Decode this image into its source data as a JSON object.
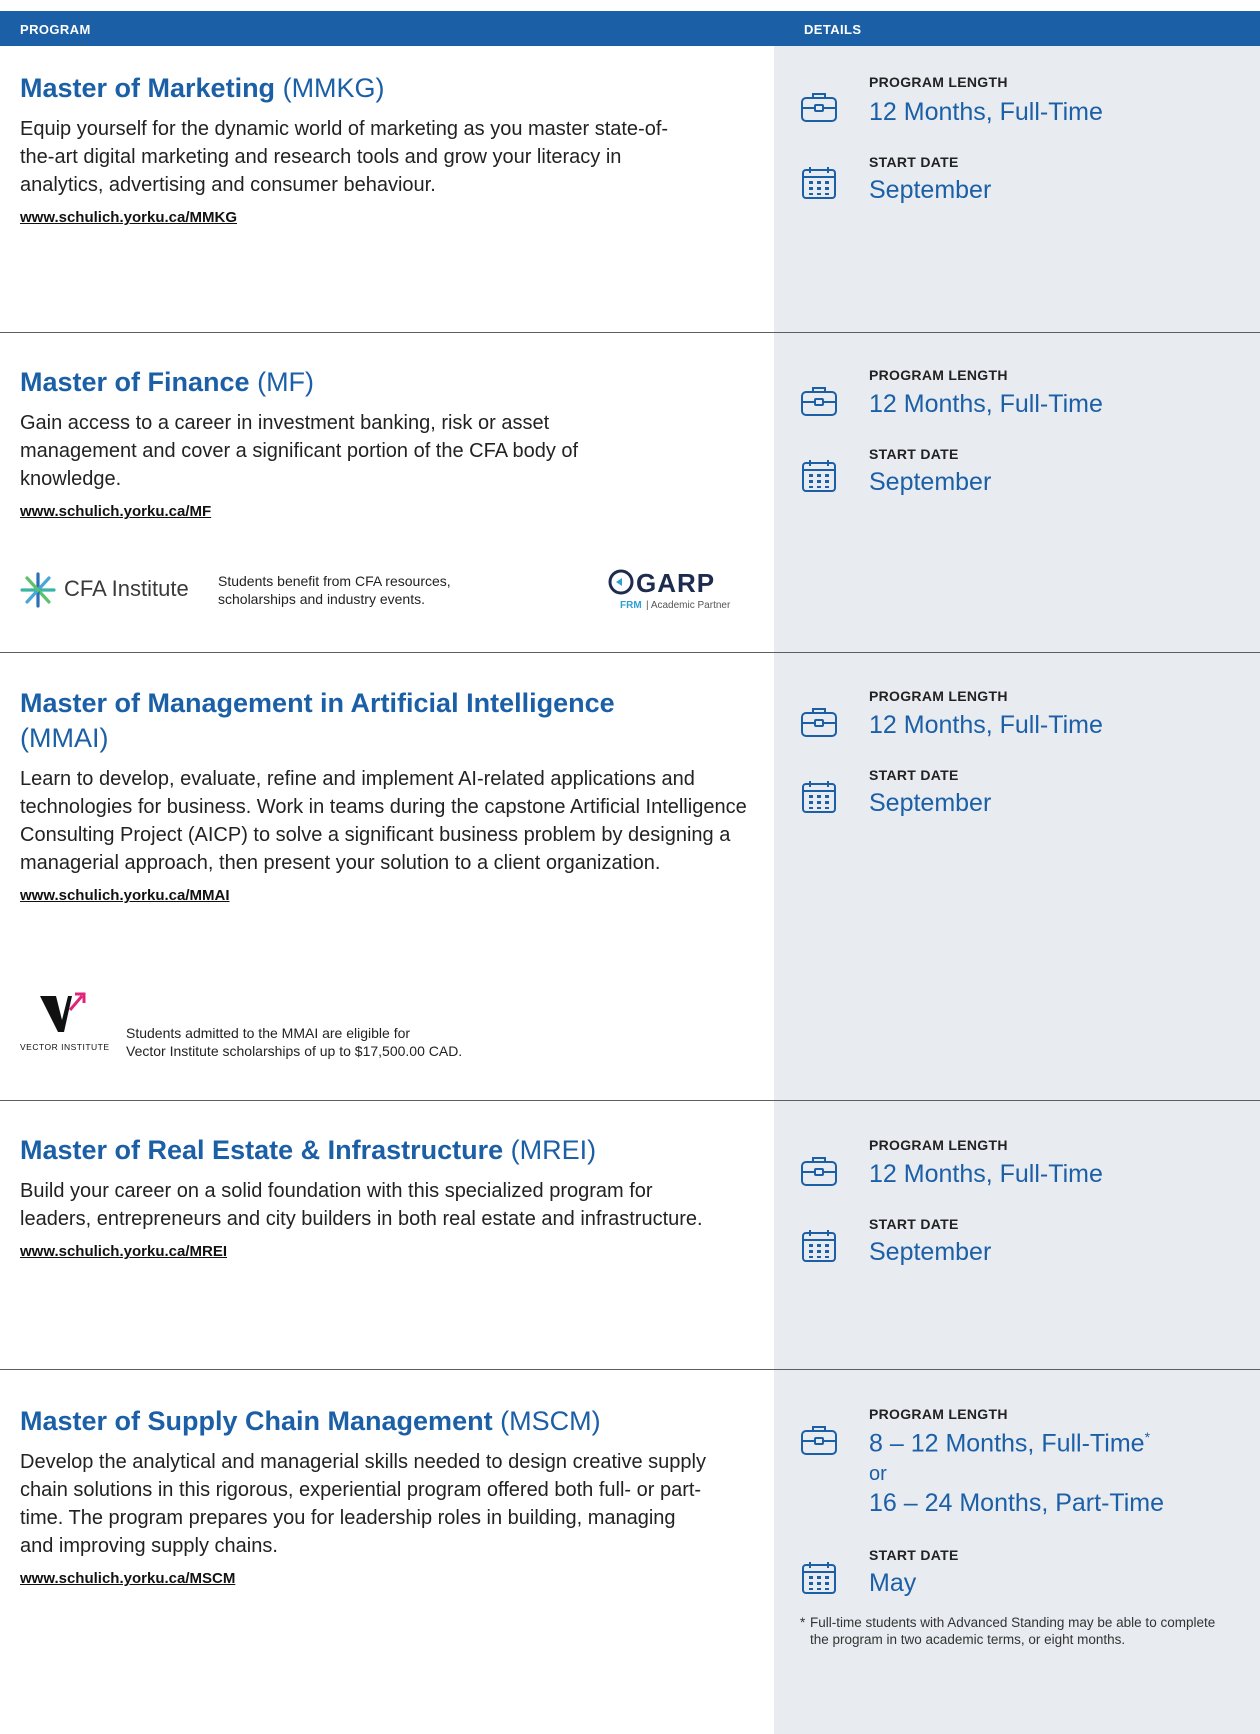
{
  "header": {
    "col_program": "PROGRAM",
    "col_details": "DETAILS"
  },
  "labels": {
    "program_length": "PROGRAM LENGTH",
    "start_date": "START DATE"
  },
  "programs": [
    {
      "name": "Master of Marketing",
      "abbr": "(MMKG)",
      "description": "Equip yourself for the dynamic world of marketing as you master state-of-the-art digital marketing and research tools and grow your literacy in analytics, advertising and consumer behaviour.",
      "url": "www.schulich.yorku.ca/MMKG",
      "length": "12 Months, Full-Time",
      "start": "September"
    },
    {
      "name": "Master of Finance",
      "abbr": "(MF)",
      "description": "Gain access to a career in investment banking, risk or asset management and cover a significant portion of the CFA body of knowledge.",
      "url": "www.schulich.yorku.ca/MF",
      "length": "12 Months, Full-Time",
      "start": "September",
      "logo_cfa": "CFA Institute",
      "partner_note": "Students benefit from CFA resources, scholarships and industry events.",
      "logo_garp": "GARP",
      "logo_garp_frm": "FRM",
      "logo_garp_sub": "| Academic Partner"
    },
    {
      "name": "Master of Management in Artificial Intelligence",
      "abbr": "(MMAI)",
      "description": "Learn to develop, evaluate, refine and implement AI-related applications and technologies for business. Work in teams during the capstone Artificial Intelligence Consulting Project (AICP) to solve a significant business problem by designing a managerial approach, then present your solution to a client organization.",
      "url": "www.schulich.yorku.ca/MMAI",
      "length": "12 Months, Full-Time",
      "start": "September",
      "logo_vector": "VECTOR INSTITUTE",
      "vector_note_1": "Students admitted to the MMAI are eligible for",
      "vector_note_2": "Vector Institute scholarships of up to $17,500.00 CAD."
    },
    {
      "name": "Master of Real Estate & Infrastructure",
      "abbr": "(MREI)",
      "description": "Build your career on a solid foundation with this specialized program for leaders, entrepreneurs and city builders in both real estate and infrastructure.",
      "url": "www.schulich.yorku.ca/MREI",
      "length": "12 Months, Full-Time",
      "start": "September"
    },
    {
      "name": "Master of Supply Chain Management",
      "abbr": "(MSCM)",
      "description": "Develop the analytical and managerial skills needed to design creative supply chain solutions in this rigorous, experiential program offered both full- or part-time. The program prepares you for leadership roles in building, managing and improving supply chains.",
      "url": "www.schulich.yorku.ca/MSCM",
      "length": "8 – 12 Months, Full-Time",
      "length_mark": "*",
      "length_or": "or",
      "length_alt": "16 – 24 Months, Part-Time",
      "start": "May",
      "footnote_mark": "*",
      "footnote": "Full-time students with Advanced Standing may be able to complete the program in two academic terms, or eight months."
    }
  ]
}
